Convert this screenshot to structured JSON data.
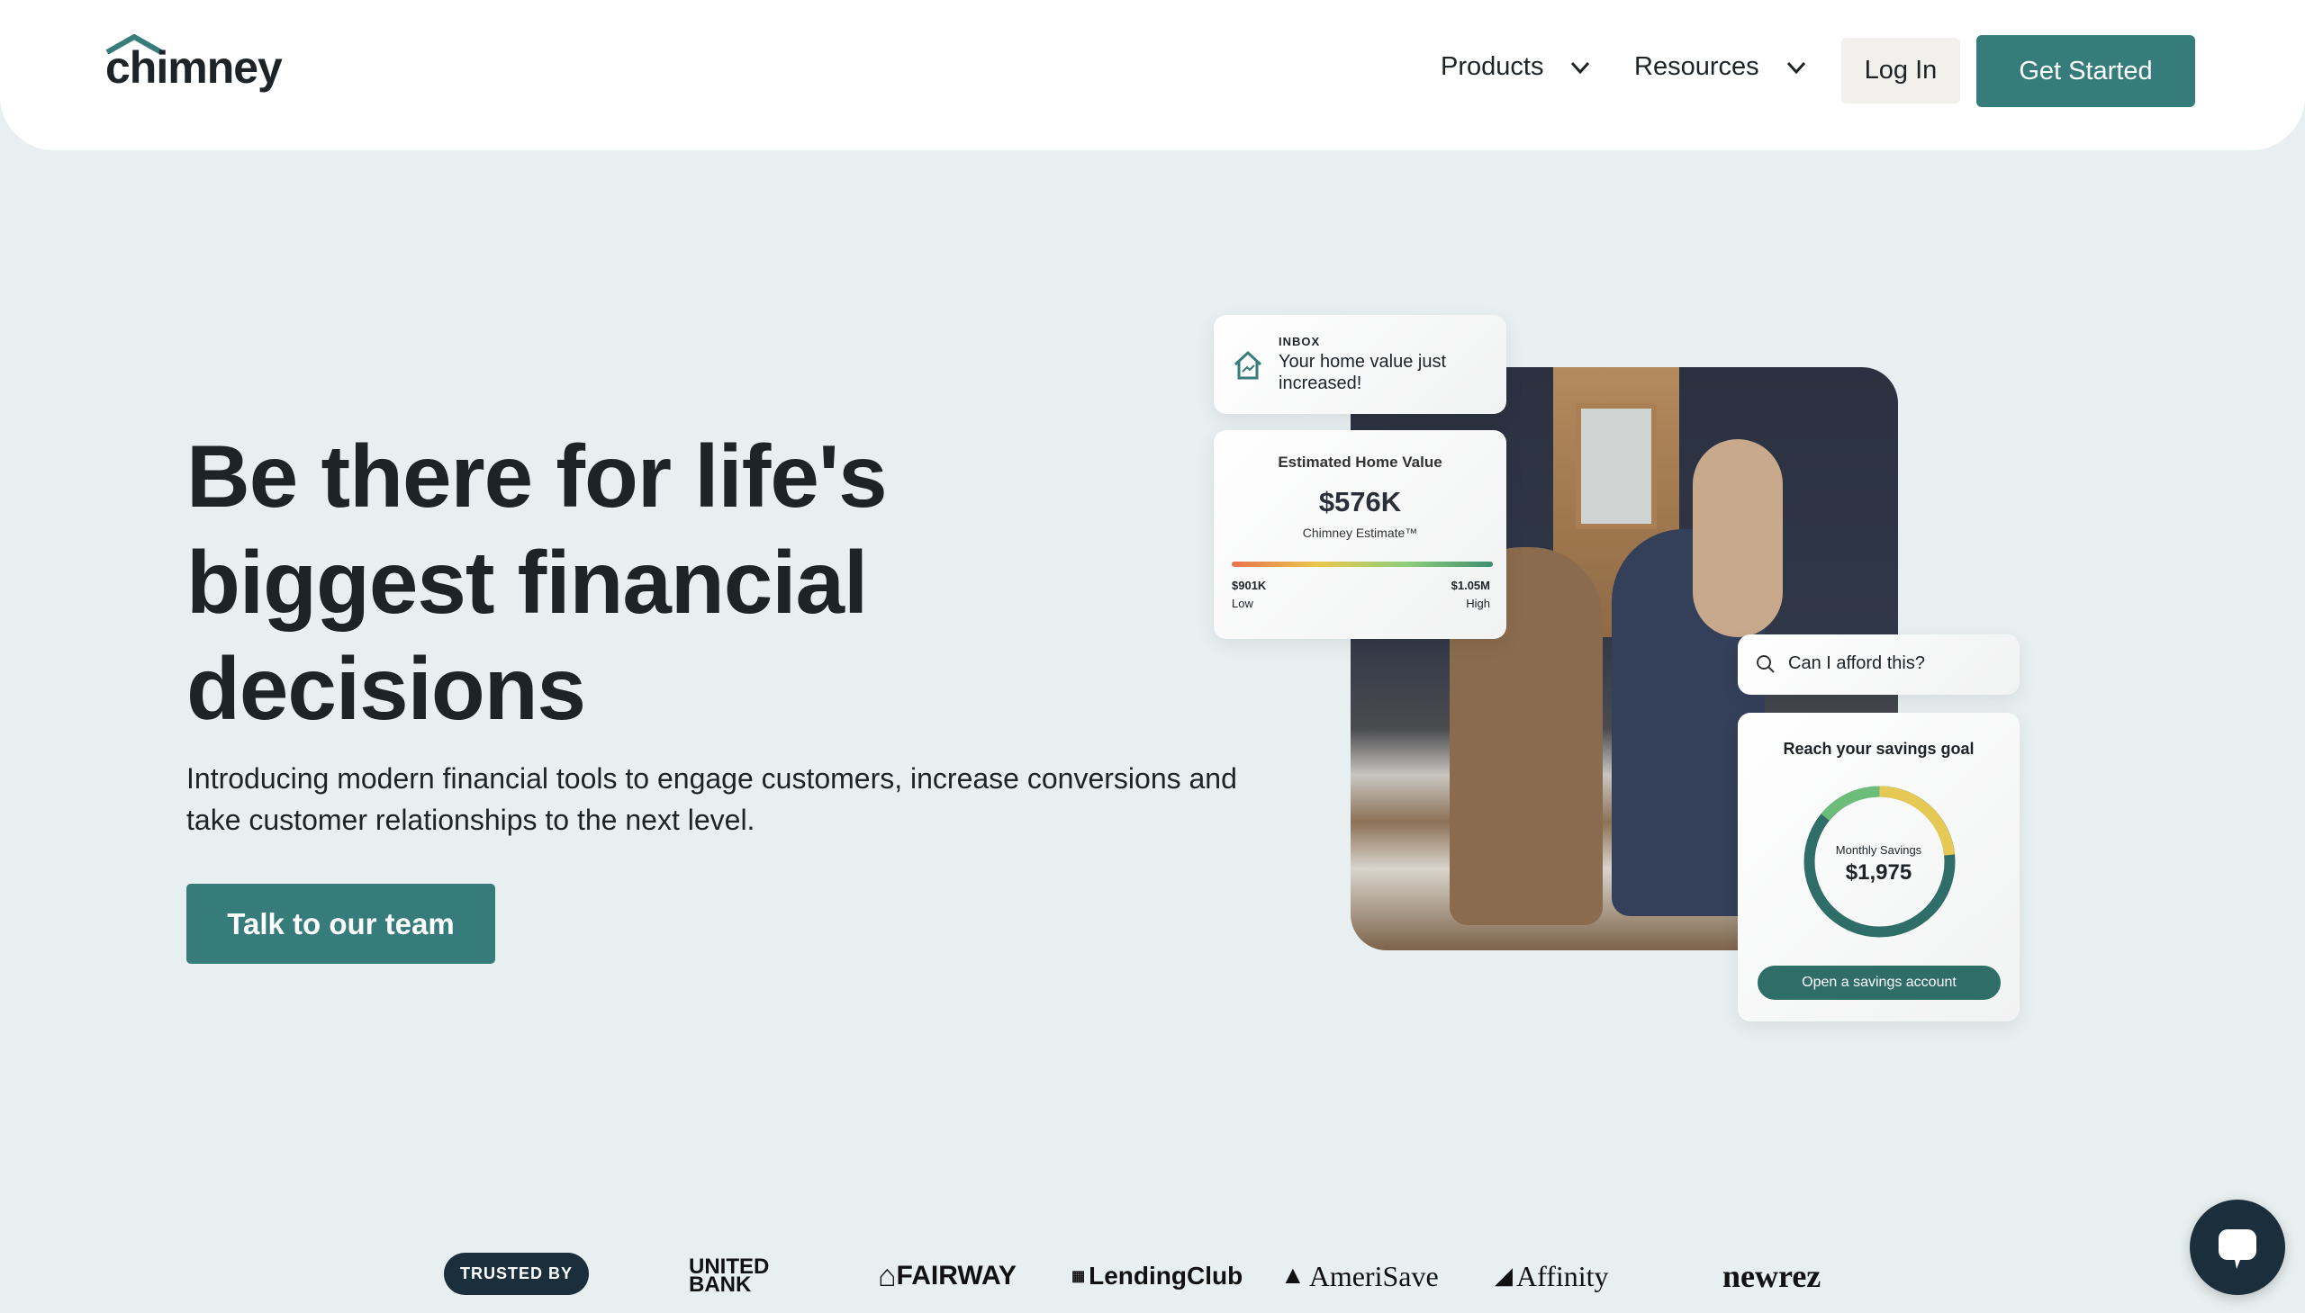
{
  "header": {
    "logo": "chimney",
    "nav": [
      {
        "label": "Products"
      },
      {
        "label": "Resources"
      }
    ],
    "login": "Log In",
    "get_started": "Get Started"
  },
  "hero": {
    "headline": "Be there for life's biggest financial decisions",
    "subtitle": "Introducing modern financial tools to engage customers, increase conversions and take customer relationships to the next level.",
    "cta": "Talk to our team"
  },
  "inbox": {
    "label": "INBOX",
    "message": "Your home value just increased!"
  },
  "home_value": {
    "title": "Estimated Home Value",
    "value": "$576K",
    "estimate_label": "Chimney Estimate™",
    "low_value": "$901K",
    "low_label": "Low",
    "high_value": "$1.05M",
    "high_label": "High"
  },
  "search": {
    "query": "Can I afford this?"
  },
  "savings": {
    "title": "Reach your savings goal",
    "monthly_label": "Monthly Savings",
    "monthly_value": "$1,975",
    "button": "Open a savings account"
  },
  "trusted": {
    "label": "TRUSTED BY",
    "logos": [
      "UNITED BANK",
      "FAIRWAY",
      "LendingClub",
      "AmeriSave",
      "Affinity",
      "newrez"
    ]
  },
  "colors": {
    "accent": "#367c7a",
    "navy": "#1b2e3c",
    "background": "#e7eff0"
  }
}
